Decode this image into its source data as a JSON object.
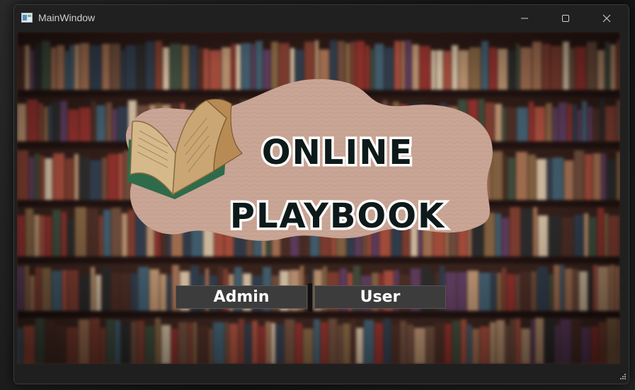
{
  "window": {
    "title": "MainWindow"
  },
  "logo": {
    "line1": "ONLINE",
    "line2": "PLAYBOOK",
    "blob_color": "#c9a595",
    "icon": "open-book-icon"
  },
  "buttons": {
    "admin_label": "Admin",
    "user_label": "User"
  },
  "colors": {
    "button_bg": "#3c3c3c",
    "titlebar_bg": "#202020"
  }
}
